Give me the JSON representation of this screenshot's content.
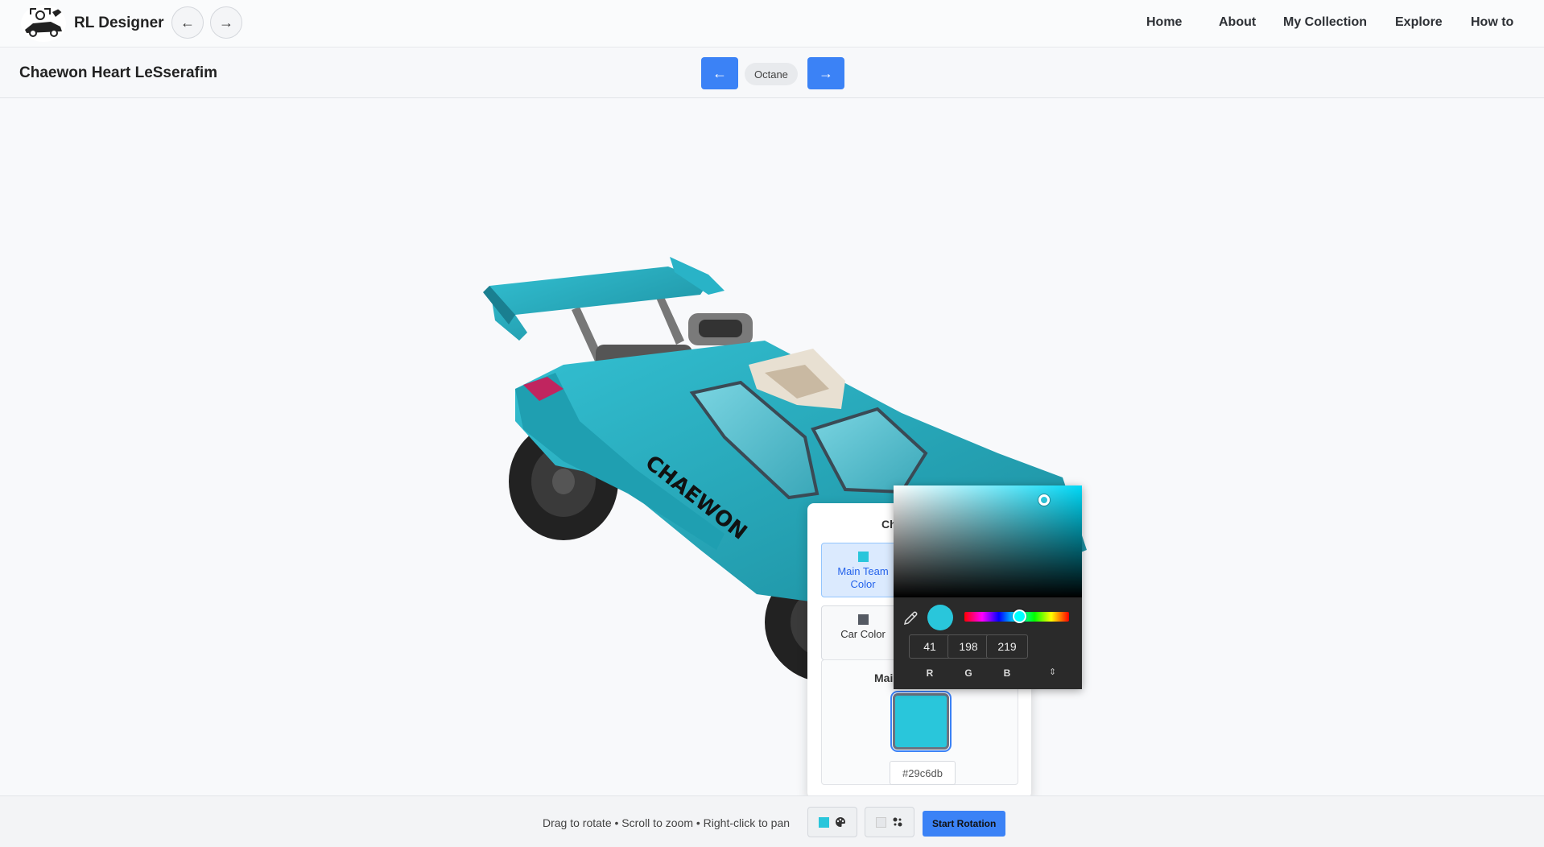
{
  "nav": {
    "brand": "RL Designer",
    "links": [
      "Home",
      "About",
      "My Collection",
      "Explore",
      "How to"
    ]
  },
  "design": {
    "title": "Chaewon Heart LeSserafim",
    "model": "Octane"
  },
  "car": {
    "decal_text": "CHAEWON"
  },
  "color_panel": {
    "title_partial": "Ch",
    "options": [
      {
        "label_line1": "Main Team",
        "label_line2": "Color",
        "swatch": "#29c6db",
        "active": true
      },
      {
        "label_line1": "Car Color",
        "label_line2": "",
        "swatch": "#555a63",
        "active": false
      }
    ],
    "main_label_partial": "Mai",
    "hex_value": "#29c6db"
  },
  "picker": {
    "r": "41",
    "g": "198",
    "b": "219",
    "labels": {
      "r": "R",
      "g": "G",
      "b": "B"
    },
    "mode_toggle": "⇕",
    "current_color": "#29c6db"
  },
  "bottombar": {
    "hint": "Drag to rotate • Scroll to zoom • Right-click to pan",
    "rotation_button": "Start Rotation"
  },
  "colors": {
    "accent": "#3b82f6",
    "car_body": "#29c6db"
  }
}
